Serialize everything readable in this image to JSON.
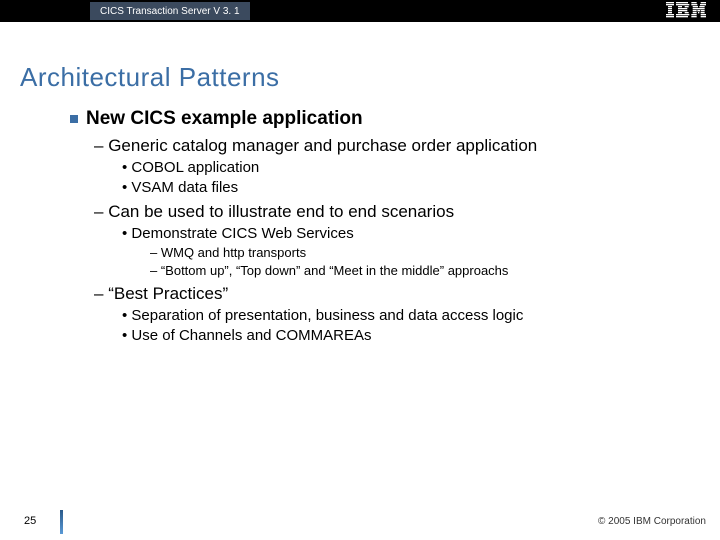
{
  "header": {
    "product": "CICS Transaction Server V 3. 1",
    "logo_name": "ibm-logo"
  },
  "title": "Architectural Patterns",
  "bullets": {
    "l1": "New CICS example application",
    "l2a": "Generic catalog manager and purchase order application",
    "l3a1": "COBOL application",
    "l3a2": "VSAM data files",
    "l2b": "Can be used to illustrate end to end scenarios",
    "l3b1": "Demonstrate CICS Web Services",
    "l4b1": "WMQ and http transports",
    "l4b2": "“Bottom up”, “Top down” and “Meet in the middle” approachs",
    "l2c": "“Best Practices”",
    "l3c1": "Separation of presentation, business and data access logic",
    "l3c2": "Use of Channels and COMMAREAs"
  },
  "footer": {
    "page": "25",
    "copyright": "© 2005 IBM Corporation"
  }
}
